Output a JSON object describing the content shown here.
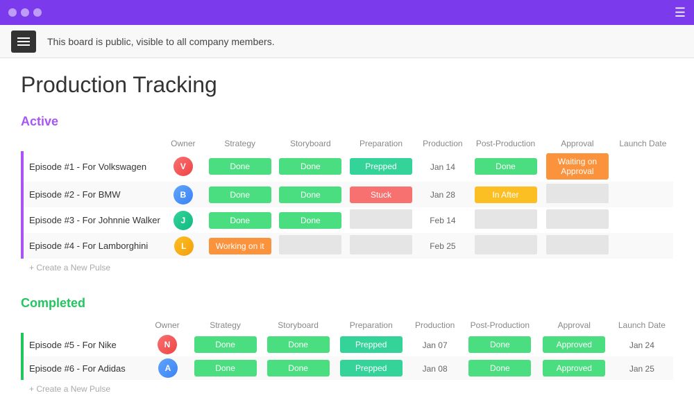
{
  "titleBar": {
    "menuIcon": "☰"
  },
  "announcement": {
    "text": "This board is public, visible to all company members.",
    "menuLabel": "≡"
  },
  "pageTitle": "Production Tracking",
  "activeSection": {
    "label": "Active",
    "columns": {
      "owner": "Owner",
      "strategy": "Strategy",
      "storyboard": "Storyboard",
      "preparation": "Preparation",
      "production": "Production",
      "postProduction": "Post-Production",
      "approval": "Approval",
      "launchDate": "Launch Date"
    },
    "rows": [
      {
        "name": "Episode #1 - For Volkswagen",
        "avatar": "1",
        "avatarLabel": "V",
        "strategy": "Done",
        "storyboard": "Done",
        "preparation": "Prepped",
        "production": "Jan 14",
        "postProduction": "Done",
        "approval": "Waiting on Approval",
        "launchDate": ""
      },
      {
        "name": "Episode #2 - For BMW",
        "avatar": "2",
        "avatarLabel": "B",
        "strategy": "Done",
        "storyboard": "Done",
        "preparation": "Stuck",
        "production": "Jan 28",
        "postProduction": "In After",
        "approval": "",
        "launchDate": ""
      },
      {
        "name": "Episode #3 - For Johnnie Walker",
        "avatar": "3",
        "avatarLabel": "J",
        "strategy": "Done",
        "storyboard": "Done",
        "preparation": "",
        "production": "Feb 14",
        "postProduction": "",
        "approval": "",
        "launchDate": ""
      },
      {
        "name": "Episode #4 - For Lamborghini",
        "avatar": "4",
        "avatarLabel": "L",
        "strategy": "Working on it",
        "storyboard": "",
        "preparation": "",
        "production": "Feb 25",
        "postProduction": "",
        "approval": "",
        "launchDate": ""
      }
    ],
    "createPulseLabel": "+ Create a New Pulse"
  },
  "completedSection": {
    "label": "Completed",
    "rows": [
      {
        "name": "Episode #5 - For Nike",
        "avatar": "1",
        "avatarLabel": "N",
        "strategy": "Done",
        "storyboard": "Done",
        "preparation": "Prepped",
        "production": "Jan 07",
        "postProduction": "Done",
        "approval": "Approved",
        "launchDate": "Jan 24"
      },
      {
        "name": "Episode #6 - For Adidas",
        "avatar": "2",
        "avatarLabel": "A",
        "strategy": "Done",
        "storyboard": "Done",
        "preparation": "Prepped",
        "production": "Jan 08",
        "postProduction": "Done",
        "approval": "Approved",
        "launchDate": "Jan 25"
      }
    ],
    "createPulseLabel": "+ Create a New Pulse"
  }
}
